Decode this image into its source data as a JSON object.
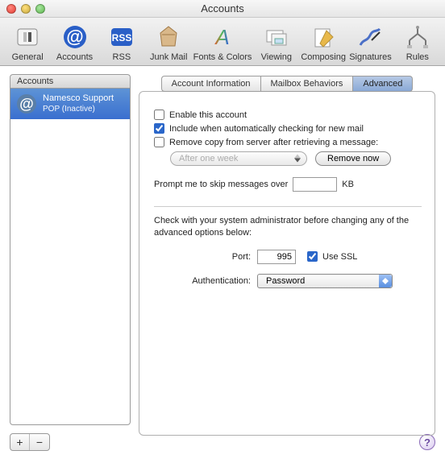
{
  "window": {
    "title": "Accounts"
  },
  "toolbar": {
    "items": [
      {
        "label": "General"
      },
      {
        "label": "Accounts"
      },
      {
        "label": "RSS"
      },
      {
        "label": "Junk Mail"
      },
      {
        "label": "Fonts & Colors"
      },
      {
        "label": "Viewing"
      },
      {
        "label": "Composing"
      },
      {
        "label": "Signatures"
      },
      {
        "label": "Rules"
      }
    ]
  },
  "sidebar": {
    "header": "Accounts",
    "accounts": [
      {
        "name": "Namesco Support",
        "sub": "POP (Inactive)"
      }
    ]
  },
  "tabs": {
    "items": [
      "Account Information",
      "Mailbox Behaviors",
      "Advanced"
    ],
    "active": 2
  },
  "advanced": {
    "enable_label": "Enable this account",
    "enable_checked": false,
    "include_label": "Include when automatically checking for new mail",
    "include_checked": true,
    "remove_label": "Remove copy from server after retrieving a message:",
    "remove_checked": false,
    "remove_after_option": "After one week",
    "remove_now_btn": "Remove now",
    "prompt_label_pre": "Prompt me to skip messages over",
    "prompt_value": "",
    "prompt_label_post": "KB",
    "admin_note": "Check with your system administrator before changing any of the advanced options below:",
    "port_label": "Port:",
    "port_value": "995",
    "ssl_label": "Use SSL",
    "ssl_checked": true,
    "auth_label": "Authentication:",
    "auth_value": "Password"
  },
  "bottom": {
    "add": "+",
    "remove": "−",
    "help": "?"
  }
}
